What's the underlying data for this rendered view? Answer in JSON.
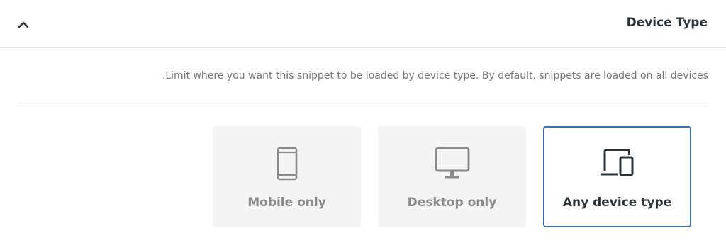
{
  "header": {
    "title": "Device Type",
    "toggle_icon": "chevron-up-icon"
  },
  "description": ".Limit where you want this snippet to be loaded by device type. By default, snippets are loaded on all devices",
  "options": [
    {
      "label": "Mobile only",
      "icon": "mobile-icon",
      "selected": false
    },
    {
      "label": "Desktop only",
      "icon": "desktop-icon",
      "selected": false
    },
    {
      "label": "Any device type",
      "icon": "any-device-icon",
      "selected": true
    }
  ],
  "colors": {
    "selected_border": "#3f6eb5",
    "card_background": "#f4f4f4",
    "muted_text": "#8a8a8a"
  }
}
